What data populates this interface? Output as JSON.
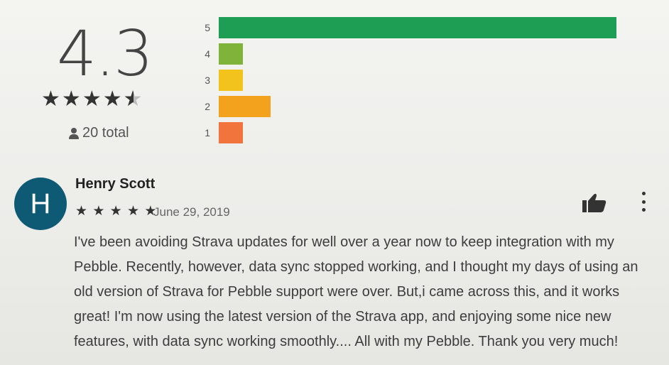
{
  "summary": {
    "average": "4.3",
    "rating_stars": 4.3,
    "total_label": "20 total",
    "icon": "person-icon"
  },
  "histogram": [
    {
      "stars": "5",
      "fraction": 1.0,
      "color": "#1e9e55"
    },
    {
      "stars": "4",
      "fraction": 0.06,
      "color": "#7fb33a"
    },
    {
      "stars": "3",
      "fraction": 0.06,
      "color": "#f2c31d"
    },
    {
      "stars": "2",
      "fraction": 0.13,
      "color": "#f2a21d"
    },
    {
      "stars": "1",
      "fraction": 0.06,
      "color": "#f0743b"
    }
  ],
  "review": {
    "avatar_letter": "H",
    "author": "Henry Scott",
    "rating": 5,
    "date": "June 29, 2019",
    "text": "I've been avoiding Strava updates for well over a year now to keep integration with my Pebble. Recently, however, data sync stopped working, and I thought my days of using an old version of Strava for Pebble support were over. But,i came across this, and it works great! I'm now using the latest version of the Strava app, and enjoying some nice new features, with data sync working smoothly.... All with my Pebble. Thank you very much!",
    "actions": [
      "thumbs-up-icon",
      "more-vert-icon"
    ]
  }
}
